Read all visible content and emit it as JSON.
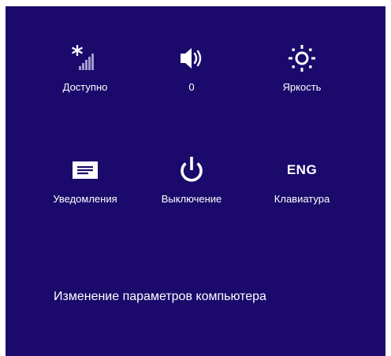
{
  "colors": {
    "panel_background": "#1b0a6b",
    "foreground": "#ffffff"
  },
  "tiles": [
    {
      "id": "network",
      "label": "Доступно",
      "icon": "wireless-signal-icon"
    },
    {
      "id": "volume",
      "label": "0",
      "icon": "speaker-icon"
    },
    {
      "id": "brightness",
      "label": "Яркость",
      "icon": "brightness-sun-icon"
    },
    {
      "id": "notifications",
      "label": "Уведомления",
      "icon": "notifications-message-icon"
    },
    {
      "id": "power",
      "label": "Выключение",
      "icon": "power-icon"
    },
    {
      "id": "keyboard",
      "label": "Клавиатура",
      "icon_text": "ENG"
    }
  ],
  "change_settings_link": "Изменение параметров компьютера"
}
